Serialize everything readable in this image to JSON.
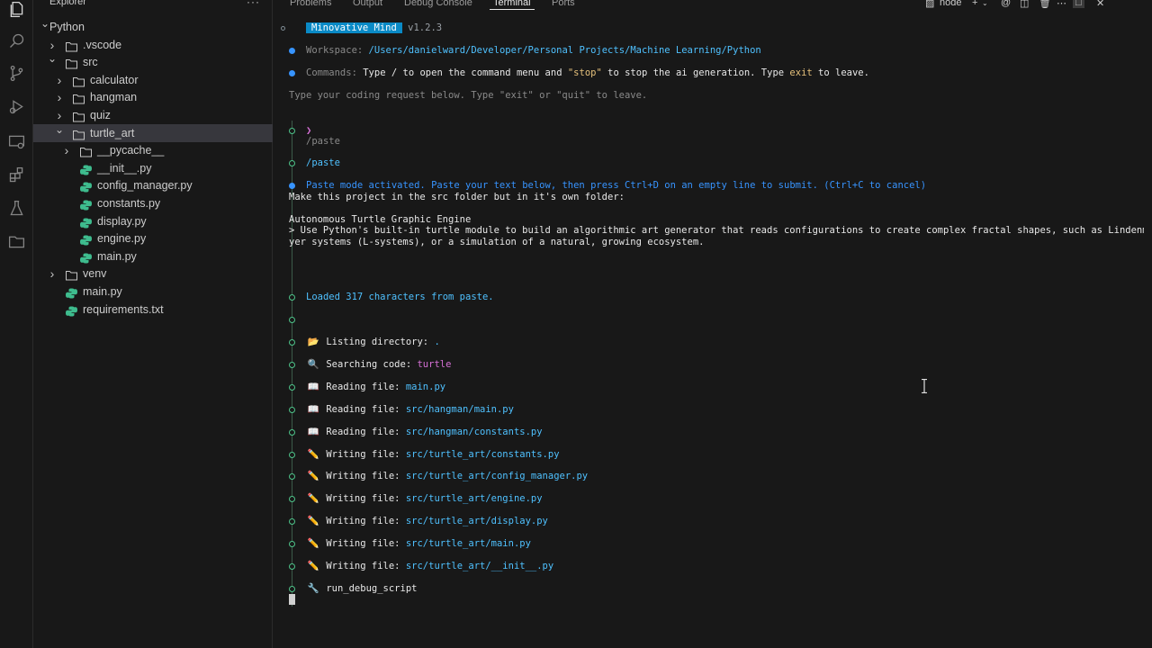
{
  "activity_icons": [
    "explorer-icon",
    "search-icon",
    "source-control-icon",
    "run-debug-icon",
    "remote-explorer-icon",
    "extensions-icon",
    "testing-icon",
    "folder-icon"
  ],
  "explorer": {
    "title": "Explorer",
    "more": "···",
    "tree": [
      {
        "label": "Python",
        "type": "root",
        "chev": "open"
      },
      {
        "label": ".vscode",
        "type": "folder",
        "chev": "closed"
      },
      {
        "label": "src",
        "type": "folder",
        "chev": "open"
      },
      {
        "label": "calculator",
        "type": "folder",
        "chev": "closed"
      },
      {
        "label": "hangman",
        "type": "folder",
        "chev": "closed"
      },
      {
        "label": "quiz",
        "type": "folder",
        "chev": "closed"
      },
      {
        "label": "turtle_art",
        "type": "folder",
        "chev": "open",
        "selected": true
      },
      {
        "label": "__pycache__",
        "type": "folder",
        "chev": "closed"
      },
      {
        "label": "__init__.py",
        "type": "py"
      },
      {
        "label": "config_manager.py",
        "type": "py"
      },
      {
        "label": "constants.py",
        "type": "py"
      },
      {
        "label": "display.py",
        "type": "py"
      },
      {
        "label": "engine.py",
        "type": "py"
      },
      {
        "label": "main.py",
        "type": "py"
      },
      {
        "label": "venv",
        "type": "folder",
        "chev": "closed"
      },
      {
        "label": "main.py",
        "type": "py"
      },
      {
        "label": "requirements.txt",
        "type": "txt"
      }
    ]
  },
  "panel": {
    "tabs": [
      "Problems",
      "Output",
      "Debug Console",
      "Terminal",
      "Ports"
    ],
    "active_tab": "Terminal",
    "terminal_name": "node"
  },
  "terminal": {
    "app_name": "Minovative Mind",
    "version": "v1.2.3",
    "workspace_label": "Workspace:",
    "workspace_path": "/Users/danielward/Developer/Personal Projects/Machine Learning/Python",
    "commands_label": "Commands:",
    "commands_text_1": "Type",
    "commands_slash": "/",
    "commands_text_2": "to open the command menu and",
    "commands_stop": "\"stop\"",
    "commands_text_3": "to stop the ai generation. Type",
    "commands_exit": "exit",
    "commands_text_4": "to leave.",
    "instruction": "Type your coding request below. Type \"exit\" or \"quit\" to leave.",
    "prompt_symbol": "❯",
    "paste_echo": "/paste",
    "paste_cmd": "/paste",
    "paste_mode": "Paste mode activated. Paste your text below, then press Ctrl+D on an empty line to submit. (Ctrl+C to cancel)",
    "pasted_1": "Make this project in the src folder but in it's own folder:",
    "pasted_2": "Autonomous Turtle Graphic Engine",
    "pasted_3": "> Use Python's built-in turtle module to build an algorithmic art generator that reads configurations to create complex fractal shapes, such as Lindenma",
    "pasted_4": "yer systems (L-systems), or a simulation of a natural, growing ecosystem.",
    "loaded": "Loaded 317 characters from paste.",
    "actions": [
      {
        "emoji": "📂",
        "label": "Listing directory:",
        "arg": "."
      },
      {
        "emoji": "🔍",
        "label": "Searching code:",
        "arg": "turtle"
      },
      {
        "emoji": "📖",
        "label": "Reading file:",
        "arg": "main.py"
      },
      {
        "emoji": "📖",
        "label": "Reading file:",
        "arg": "src/hangman/main.py"
      },
      {
        "emoji": "📖",
        "label": "Reading file:",
        "arg": "src/hangman/constants.py"
      },
      {
        "emoji": "✏️",
        "label": "Writing file:",
        "arg": "src/turtle_art/constants.py"
      },
      {
        "emoji": "✏️",
        "label": "Writing file:",
        "arg": "src/turtle_art/config_manager.py"
      },
      {
        "emoji": "✏️",
        "label": "Writing file:",
        "arg": "src/turtle_art/engine.py"
      },
      {
        "emoji": "✏️",
        "label": "Writing file:",
        "arg": "src/turtle_art/display.py"
      },
      {
        "emoji": "✏️",
        "label": "Writing file:",
        "arg": "src/turtle_art/main.py"
      },
      {
        "emoji": "✏️",
        "label": "Writing file:",
        "arg": "src/turtle_art/__init__.py"
      },
      {
        "emoji": "🔧",
        "label": "run_debug_script",
        "arg": ""
      }
    ]
  },
  "colors": {
    "accent": "#0a8ac6",
    "link": "#3794ff",
    "magenta": "#d670d6",
    "green_marker": "#4ec58a"
  }
}
